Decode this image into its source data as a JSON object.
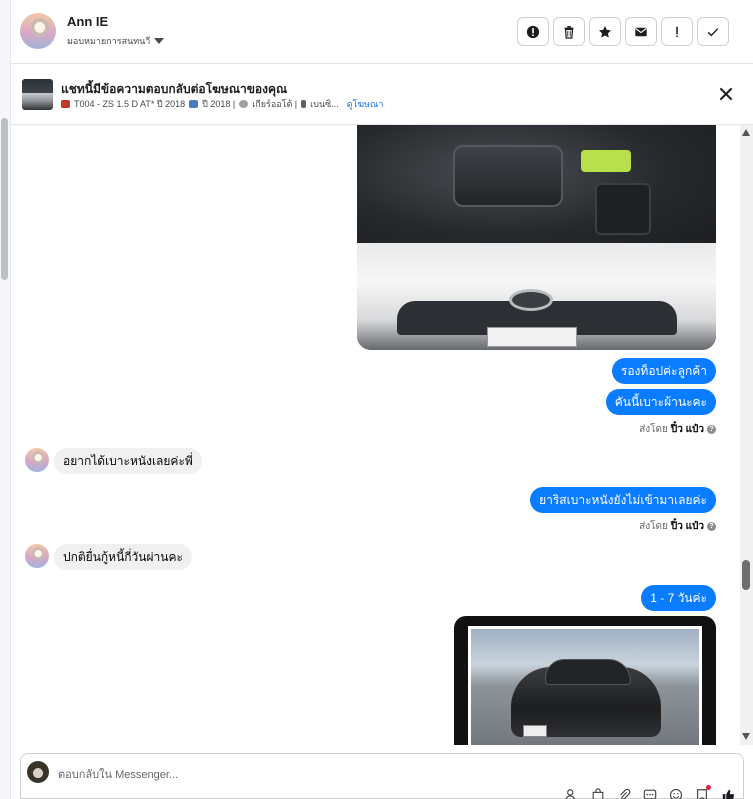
{
  "header": {
    "name": "Ann IE",
    "subtitle": "มอบหมายการสนทนาี",
    "actions": [
      {
        "label": "important",
        "icon": "alert-circle-icon"
      },
      {
        "label": "delete",
        "icon": "trash-icon"
      },
      {
        "label": "star",
        "icon": "star-icon"
      },
      {
        "label": "mail",
        "icon": "envelope-icon"
      },
      {
        "label": "follow up",
        "icon": "exclamation-icon"
      },
      {
        "label": "done",
        "icon": "check-icon"
      }
    ]
  },
  "banner": {
    "title": "แชทนี้มีข้อความตอบกลับต่อโฆษณาของคุณ",
    "meta_model": "T004 - ZS 1.5 D AT* ปี 2018",
    "meta_year": "ปี 2018 |",
    "meta_gear": "เกียร์ออโต้ |",
    "meta_fuel": "เบนซิ...",
    "link": "ดูโฆษณา"
  },
  "messages": {
    "out1": "รองท็อปค่ะลูกค้า",
    "out2": "คันนี้เบาะผ้านะคะ",
    "sent_label": "ส่งโดย",
    "sender": "ปิ๋ว แป๋ว",
    "in1": "อยากได้เบาะหนังเลยค่ะพี่",
    "out3": "ยาริสเบาะหนังยังไม่เข้ามาเลยค่ะ",
    "in2": "ปกติยื่นกู้หนี้กี่วันผ่านคะ",
    "out4": "1 - 7 วันค่ะ",
    "help_glyph": "?"
  },
  "composer": {
    "placeholder": "ตอบกลับใน Messenger..."
  },
  "colors": {
    "accent": "#0a7cff",
    "link": "#1a73e8",
    "incoming_bubble": "#f0f0f0"
  }
}
